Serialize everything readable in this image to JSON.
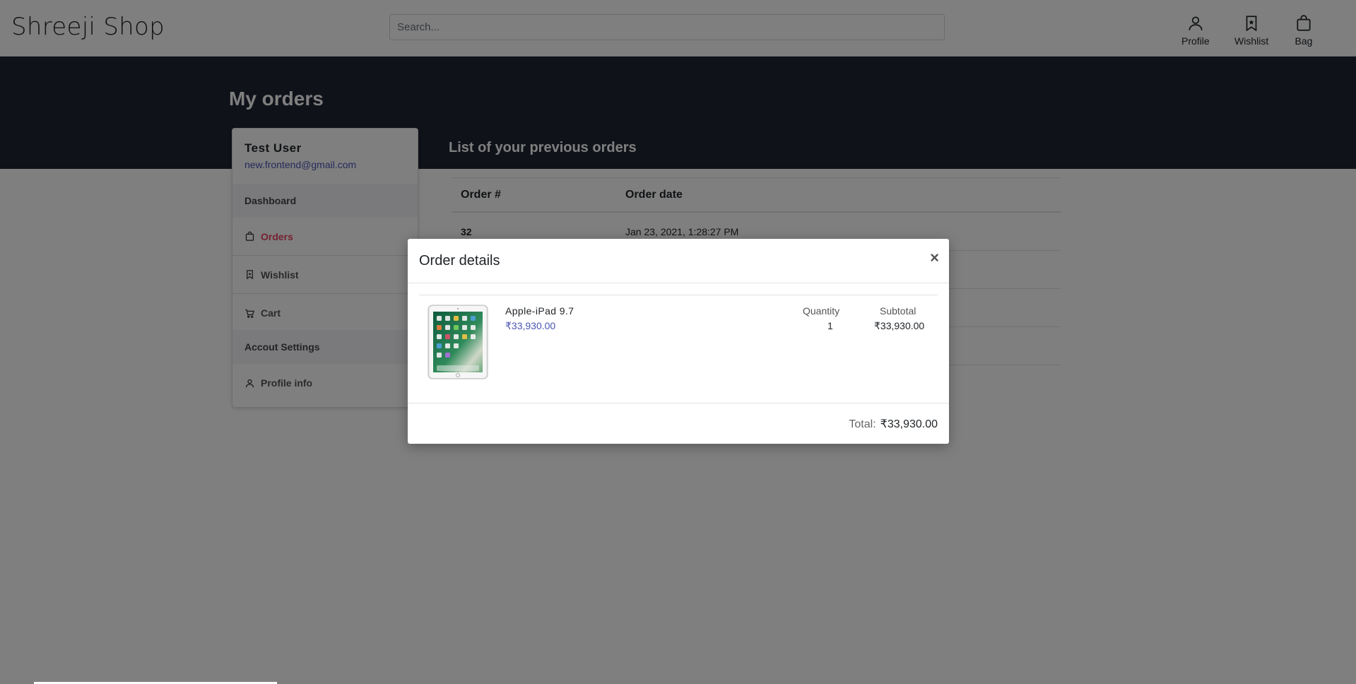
{
  "header": {
    "brand": "Shreeji Shop",
    "search_placeholder": "Search...",
    "nav": [
      {
        "label": "Profile",
        "icon": "user-icon"
      },
      {
        "label": "Wishlist",
        "icon": "bookmark-icon"
      },
      {
        "label": "Bag",
        "icon": "bag-icon"
      }
    ]
  },
  "page": {
    "title": "My orders",
    "list_title": "List of your previous orders"
  },
  "sidebar": {
    "user_name": "Test User",
    "user_email": "new.frontend@gmail.com",
    "sections": [
      "Dashboard",
      "Accout Settings"
    ],
    "items": [
      {
        "label": "Orders",
        "icon": "bag-icon",
        "active": true
      },
      {
        "label": "Wishlist",
        "icon": "bookmark-icon",
        "active": false
      },
      {
        "label": "Cart",
        "icon": "cart-icon",
        "active": false
      },
      {
        "label": "Profile info",
        "icon": "user-icon",
        "active": false
      }
    ]
  },
  "orders": {
    "columns": [
      "Order #",
      "Order date"
    ],
    "rows": [
      {
        "number": "32",
        "date": "Jan 23, 2021, 1:28:27 PM"
      }
    ]
  },
  "modal": {
    "title": "Order details",
    "close": "×",
    "item": {
      "name": "Apple-iPad 9.7",
      "price": "₹33,930.00",
      "quantity_label": "Quantity",
      "quantity": "1",
      "subtotal_label": "Subtotal",
      "subtotal": "₹33,930.00"
    },
    "total_label": "Total:",
    "total": "₹33,930.00"
  },
  "colors": {
    "hero": "#1e2532",
    "accent": "#e94560",
    "link": "#4a55b4"
  }
}
